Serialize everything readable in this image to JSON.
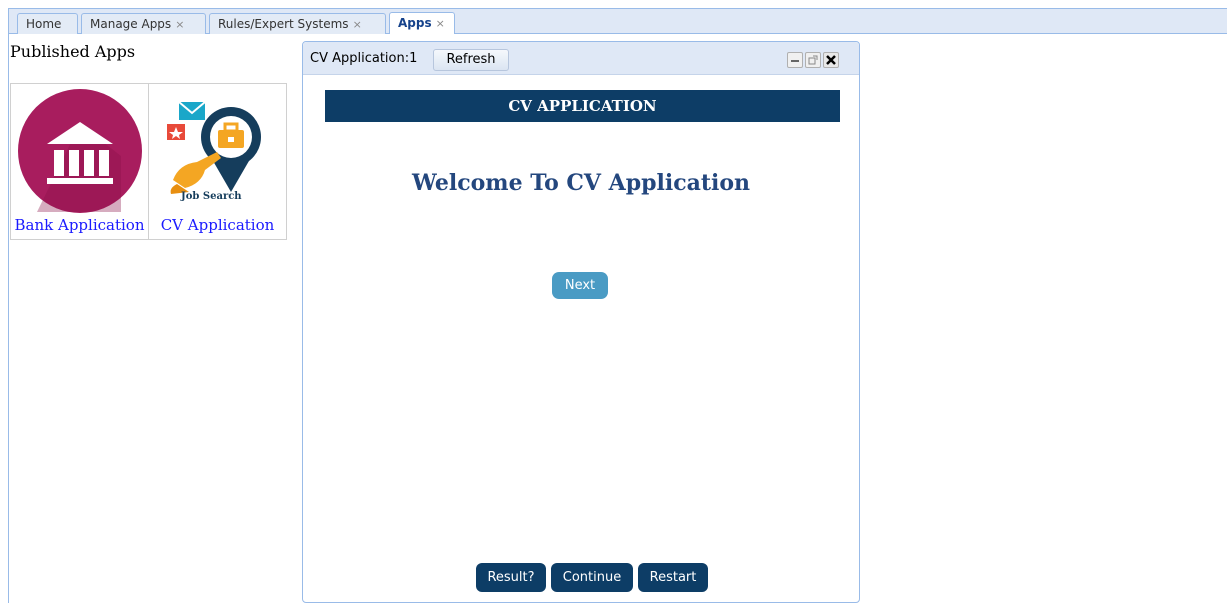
{
  "tabs": [
    {
      "label": "Home",
      "closable": false,
      "active": false
    },
    {
      "label": "Manage Apps",
      "closable": true,
      "active": false
    },
    {
      "label": "Rules/Expert Systems",
      "closable": true,
      "active": false
    },
    {
      "label": "Apps",
      "closable": true,
      "active": true
    }
  ],
  "close_glyph": "×",
  "published": {
    "title": "Published Apps",
    "apps": [
      {
        "label": "Bank Application",
        "icon": "bank-icon"
      },
      {
        "label": "CV Application",
        "icon": "job-search-icon",
        "icon_text": "Job Search"
      }
    ]
  },
  "window": {
    "title": "CV Application:1",
    "refresh_label": "Refresh",
    "banner": "CV APPLICATION",
    "welcome": "Welcome To CV Application",
    "next_label": "Next",
    "buttons": {
      "result": "Result?",
      "continue": "Continue",
      "restart": "Restart"
    }
  },
  "colors": {
    "tab_bar": "#dfe8f6",
    "banner": "#0d3d66",
    "welcome_text": "#24477e",
    "next_button": "#4a9bc4",
    "link": "#1a1aff",
    "bank_icon": "#a81d5e"
  }
}
